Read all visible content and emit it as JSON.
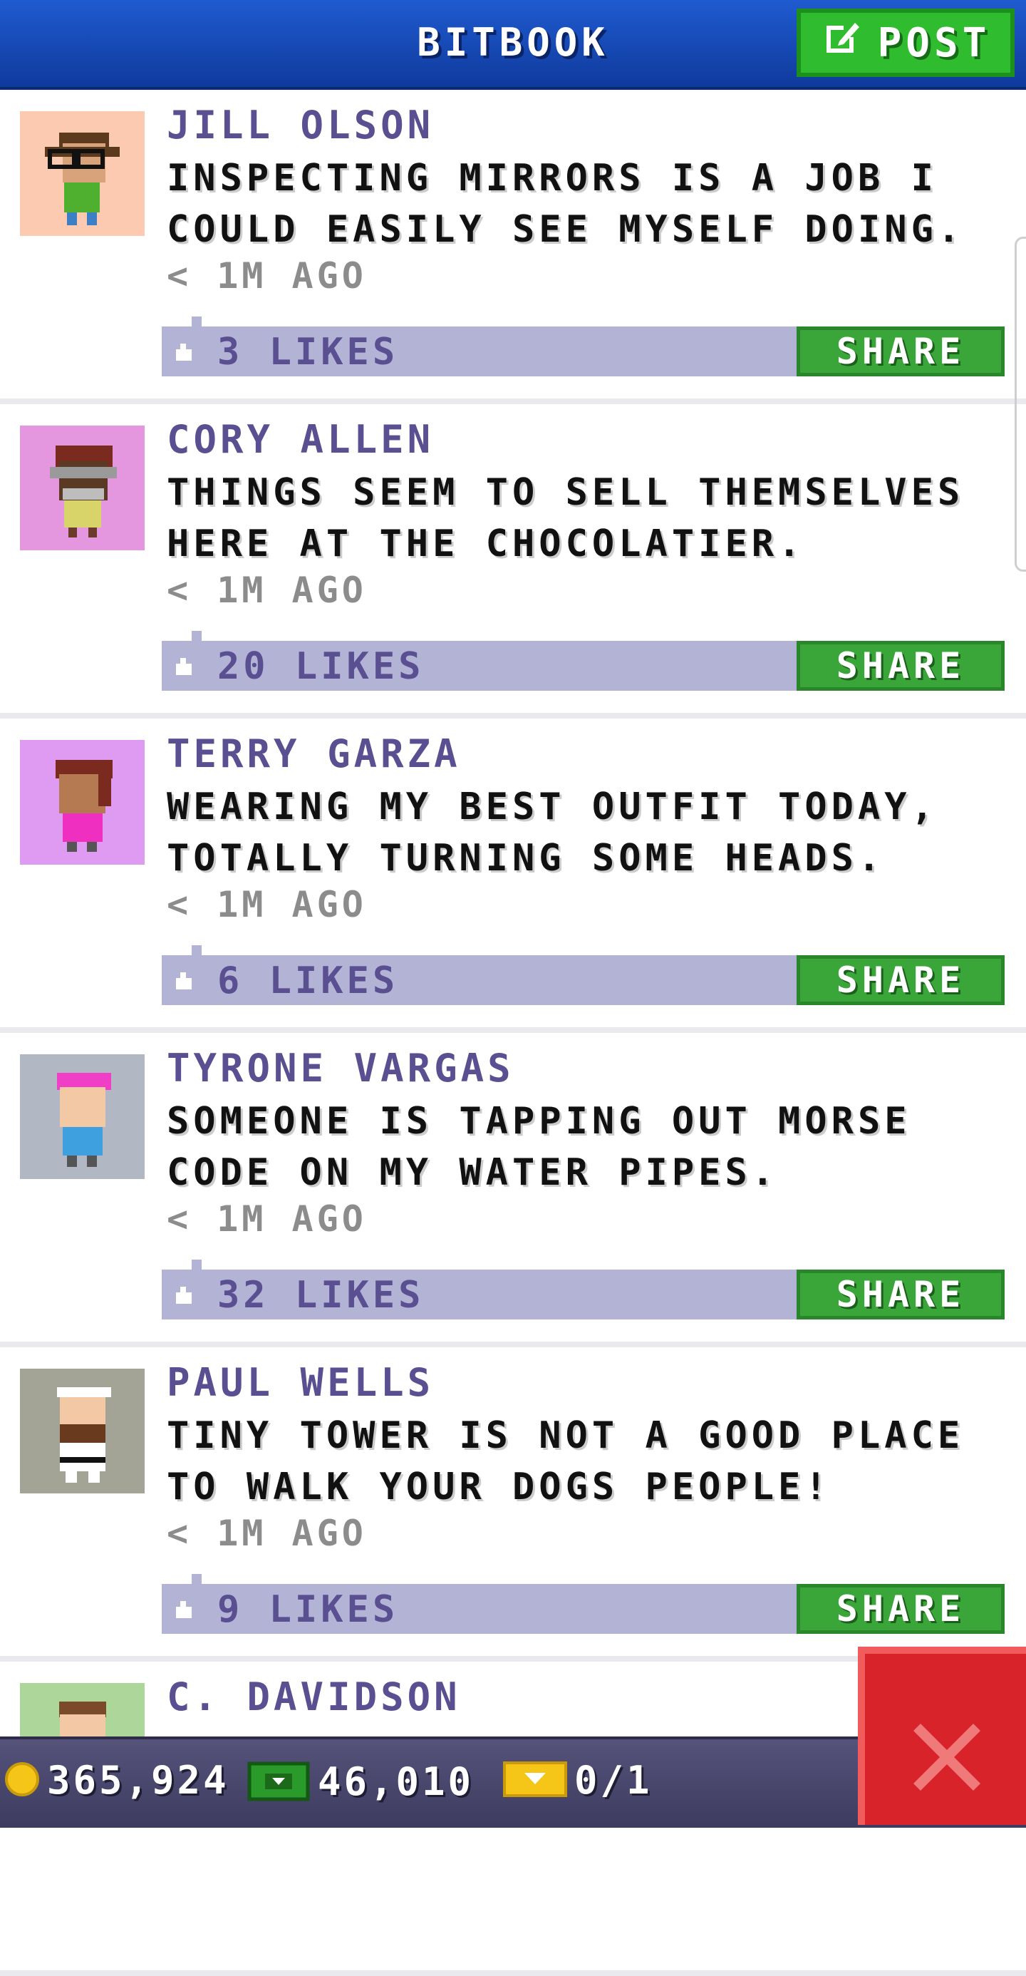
{
  "header": {
    "title": "BITBOOK",
    "post_label": "POST"
  },
  "posts": [
    {
      "author": "JILL OLSON",
      "message": "INSPECTING MIRRORS IS A JOB I COULD EASILY SEE MYSELF DOING.",
      "time": "< 1M AGO",
      "likes": "3 LIKES",
      "share_label": "SHARE",
      "avatar_bg": "#fccab0"
    },
    {
      "author": "CORY ALLEN",
      "message": "THINGS SEEM TO SELL THEMSELVES HERE AT THE CHOCOLATIER.",
      "time": "< 1M AGO",
      "likes": "20 LIKES",
      "share_label": "SHARE",
      "avatar_bg": "#e496de"
    },
    {
      "author": "TERRY GARZA",
      "message": "WEARING MY BEST OUTFIT TODAY, TOTALLY TURNING SOME HEADS.",
      "time": "< 1M AGO",
      "likes": "6 LIKES",
      "share_label": "SHARE",
      "avatar_bg": "#de9bf1"
    },
    {
      "author": "TYRONE VARGAS",
      "message": "SOMEONE IS TAPPING OUT MORSE CODE ON MY WATER PIPES.",
      "time": "< 1M AGO",
      "likes": "32 LIKES",
      "share_label": "SHARE",
      "avatar_bg": "#b1b8c3"
    },
    {
      "author": "PAUL WELLS",
      "message": "TINY TOWER IS NOT A GOOD PLACE TO WALK YOUR DOGS PEOPLE!",
      "time": "< 1M AGO",
      "likes": "9 LIKES",
      "share_label": "SHARE",
      "avatar_bg": "#a3a396"
    },
    {
      "author": "C. DAVIDSON",
      "message": "",
      "time": "",
      "likes": "",
      "share_label": "",
      "avatar_bg": "#add69a"
    }
  ],
  "status_bar": {
    "coins": "365,924",
    "bux": "46,010",
    "tickets": "0/1"
  },
  "colors": {
    "header_blue": "#1f5bd0",
    "post_green": "#2fbc2f",
    "likes_bar": "#b3b3d6",
    "close_red": "#d8232a",
    "bottom_bar": "#4b4970"
  },
  "icons": {
    "post": "edit-icon",
    "like": "thumbs-up-icon",
    "coin": "coin-icon",
    "bux": "bux-icon",
    "ticket": "ticket-icon",
    "close": "close-icon"
  }
}
